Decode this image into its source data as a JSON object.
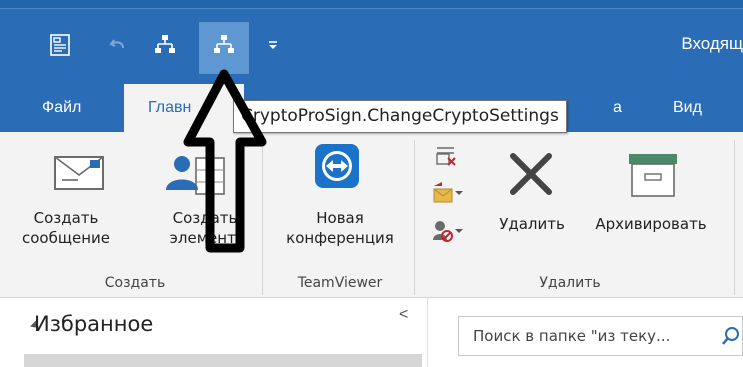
{
  "quick_access": {
    "title": "Входящ",
    "icons": [
      "message-icon",
      "undo-icon",
      "network-icon",
      "network-icon-active",
      "customize-dropdown-icon"
    ]
  },
  "tabs": [
    {
      "label": "Файл"
    },
    {
      "label": "Главн"
    },
    {
      "label": "а"
    },
    {
      "label": "Вид"
    }
  ],
  "tooltip": {
    "text": "CryptoProSign.ChangeCryptoSettings"
  },
  "ribbon": {
    "create_message": {
      "line1": "Создать",
      "line2": "сообщение"
    },
    "create_item": {
      "line1": "Созд",
      "line1b": "ать",
      "line2": "элемен",
      "line2b": "т"
    },
    "new_conference": {
      "line1": "Новая",
      "line2": "конференция"
    },
    "delete": {
      "label": "Удалить"
    },
    "archive": {
      "label": "Архивировать"
    },
    "groups": {
      "create": "Создать",
      "teamviewer": "TeamViewer",
      "delete": "Удалить"
    }
  },
  "nav": {
    "favorites": "Избранное",
    "collapse_glyph": "<"
  },
  "search": {
    "placeholder": "Поиск в папке \"из теку..."
  },
  "colors": {
    "accent": "#2b6cb6",
    "ribbon_bg": "#f3f3f3",
    "highlight": "#5e97d2",
    "delete_red": "#c4262e"
  }
}
